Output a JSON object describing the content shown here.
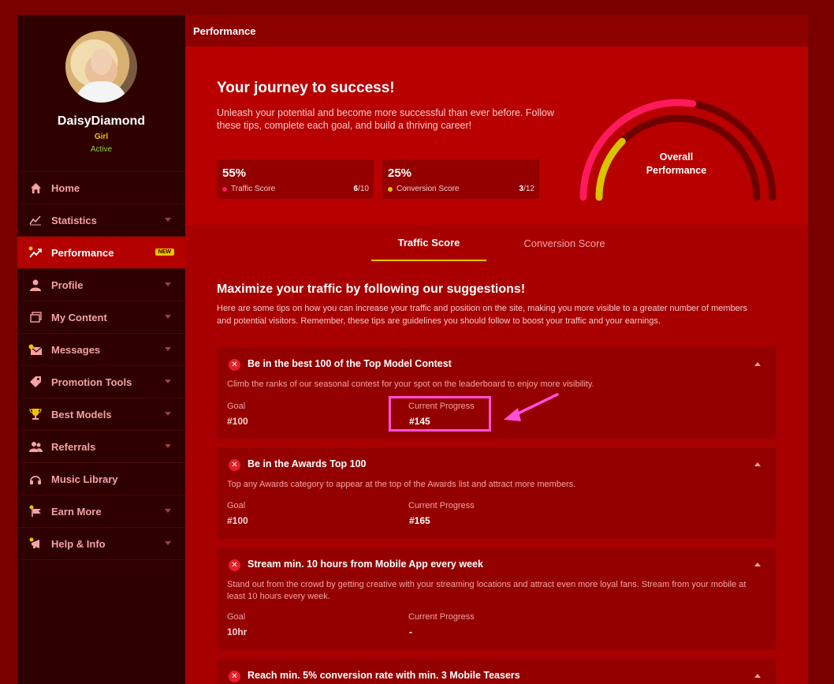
{
  "colors": {
    "accent_yellow": "#f2c200",
    "brand_red": "#b80000",
    "gauge_pink": "#ff1a5c",
    "highlight_magenta": "#ff4fd8",
    "error_red": "#e61e2d"
  },
  "profile": {
    "name": "DaisyDiamond",
    "type": "Girl",
    "status": "Active"
  },
  "sidebar": {
    "items": [
      {
        "label": "Home",
        "icon": "home-icon",
        "caret": false
      },
      {
        "label": "Statistics",
        "icon": "chart-line-icon",
        "caret": true
      },
      {
        "label": "Performance",
        "icon": "performance-icon",
        "caret": false,
        "badge": "NEW",
        "active": true
      },
      {
        "label": "Profile",
        "icon": "user-icon",
        "caret": true
      },
      {
        "label": "My Content",
        "icon": "content-icon",
        "caret": true
      },
      {
        "label": "Messages",
        "icon": "messages-icon",
        "caret": true
      },
      {
        "label": "Promotion Tools",
        "icon": "tag-icon",
        "caret": true
      },
      {
        "label": "Best Models",
        "icon": "trophy-icon",
        "caret": true
      },
      {
        "label": "Referrals",
        "icon": "users-icon",
        "caret": true
      },
      {
        "label": "Music Library",
        "icon": "headphones-icon",
        "caret": false
      },
      {
        "label": "Earn More",
        "icon": "flag-icon",
        "caret": true
      },
      {
        "label": "Help & Info",
        "icon": "megaphone-icon",
        "caret": true
      }
    ]
  },
  "header": {
    "title": "Performance"
  },
  "hero": {
    "title": "Your journey to success!",
    "description": "Unleash your potential and become more successful than ever before. Follow these tips, complete each goal, and build a thriving career!",
    "traffic": {
      "percent": "55%",
      "label": "Traffic Score",
      "done": "6",
      "total": "/10",
      "value": 0.55,
      "color": "#ff1a5c"
    },
    "conversion": {
      "percent": "25%",
      "label": "Conversion Score",
      "done": "3",
      "total": "/12",
      "value": 0.25,
      "color": "#d9c400"
    },
    "gauge_label_line1": "Overall",
    "gauge_label_line2": "Performance"
  },
  "tabs": [
    {
      "label": "Traffic Score",
      "active": true
    },
    {
      "label": "Conversion Score",
      "active": false
    }
  ],
  "section": {
    "title": "Maximize your traffic by following our suggestions!",
    "description": "Here are some tips on how you can increase your traffic and position on the site, making you more visible to a greater number of members and potential visitors. Remember, these tips are guidelines you should follow to boost your traffic and your earnings."
  },
  "tasks": [
    {
      "title": "Be in the best 100 of the Top Model Contest",
      "description": "Climb the ranks of our seasonal contest for your spot on the leaderboard to enjoy more visibility.",
      "goal_label": "Goal",
      "goal": "#100",
      "progress_label": "Current Progress",
      "progress": "#145"
    },
    {
      "title": "Be in the Awards Top 100",
      "description": "Top any Awards category to appear at the top of the Awards list and attract more members.",
      "goal_label": "Goal",
      "goal": "#100",
      "progress_label": "Current Progress",
      "progress": "#165"
    },
    {
      "title": "Stream min. 10 hours from Mobile App every week",
      "description": "Stand out from the crowd by getting creative with your streaming locations and attract even more loyal fans. Stream from your mobile at least 10 hours every week.",
      "goal_label": "Goal",
      "goal": "10hr",
      "progress_label": "Current Progress",
      "progress": "-"
    },
    {
      "title": "Reach min. 5% conversion rate with min. 3 Mobile Teasers"
    }
  ]
}
